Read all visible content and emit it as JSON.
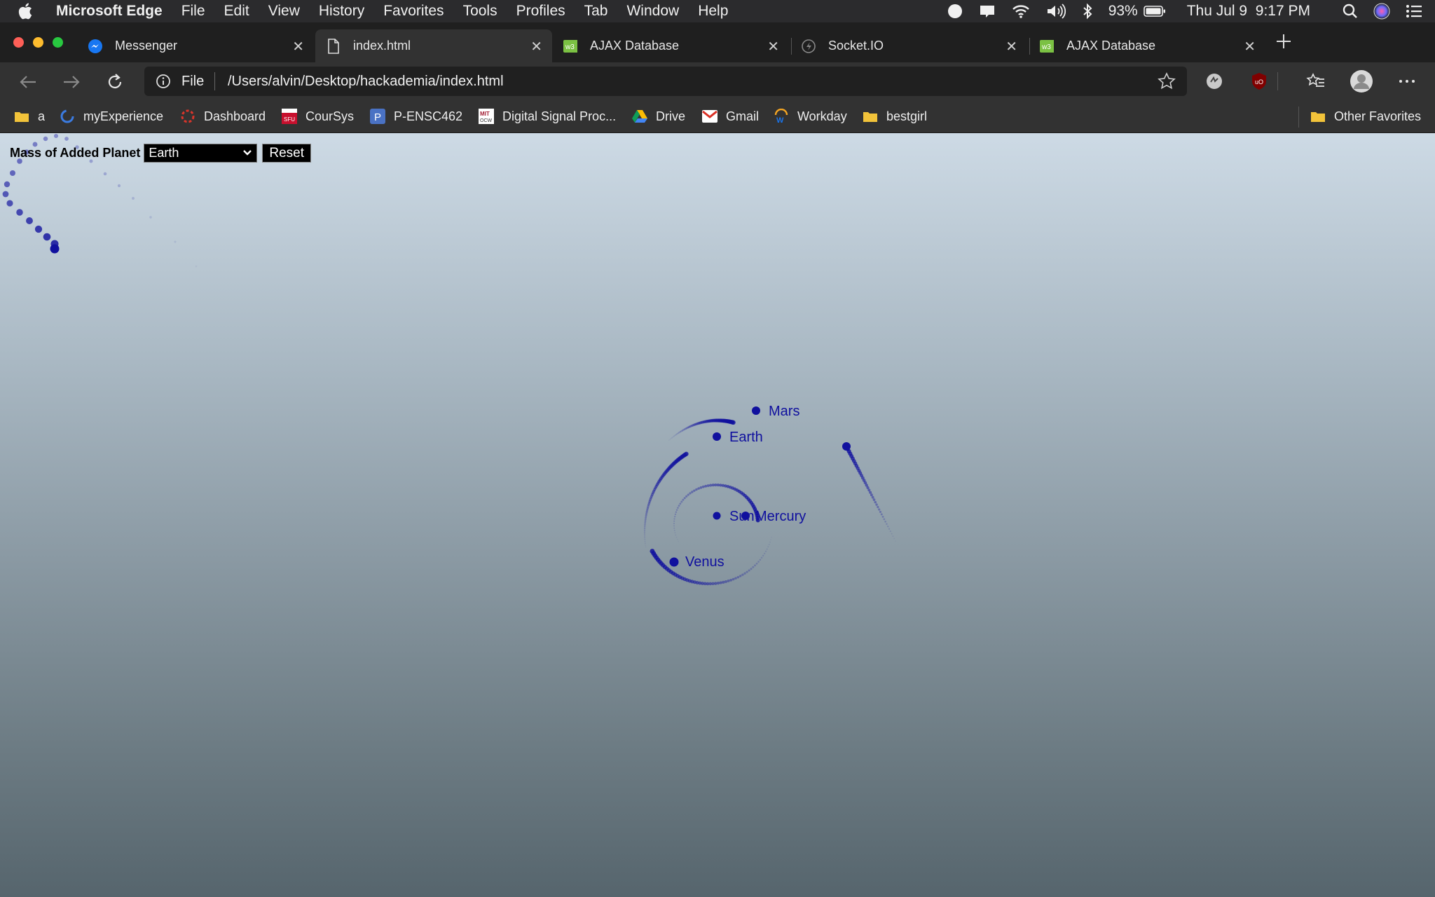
{
  "menubar": {
    "app_name": "Microsoft Edge",
    "menus": [
      "File",
      "Edit",
      "View",
      "History",
      "Favorites",
      "Tools",
      "Profiles",
      "Tab",
      "Window",
      "Help"
    ],
    "battery": "93%",
    "clock": "Thu Jul 9  9:17 PM"
  },
  "tabs": [
    {
      "title": "Messenger",
      "icon": "messenger-icon"
    },
    {
      "title": "index.html",
      "icon": "file-icon"
    },
    {
      "title": "AJAX Database",
      "icon": "ajax-icon"
    },
    {
      "title": "Socket.IO",
      "icon": "socketio-icon"
    },
    {
      "title": "AJAX Database",
      "icon": "ajax-icon"
    }
  ],
  "toolbar": {
    "scheme": "File",
    "url": "/Users/alvin/Desktop/hackademia/index.html"
  },
  "bookmarks": {
    "items": [
      {
        "label": "a",
        "icon": "folder-icon"
      },
      {
        "label": "myExperience",
        "icon": "myexperience-icon"
      },
      {
        "label": "Dashboard",
        "icon": "dashboard-icon"
      },
      {
        "label": "CourSys",
        "icon": "sfu-icon"
      },
      {
        "label": "P-ENSC462",
        "icon": "p-icon"
      },
      {
        "label": "Digital Signal Proc...",
        "icon": "mit-ocw-icon"
      },
      {
        "label": "Drive",
        "icon": "drive-icon"
      },
      {
        "label": "Gmail",
        "icon": "gmail-icon"
      },
      {
        "label": "Workday",
        "icon": "workday-icon"
      },
      {
        "label": "bestgirl",
        "icon": "folder-icon"
      }
    ],
    "other": "Other Favorites"
  },
  "page": {
    "mass_label": "Mass of Added Planet",
    "mass_selected": "Earth",
    "reset_label": "Reset",
    "planets": {
      "mars": "Mars",
      "earth": "Earth",
      "sun": "Sun",
      "mercury": "Mercury",
      "venus": "Venus"
    },
    "planet_color": "#10109e"
  }
}
